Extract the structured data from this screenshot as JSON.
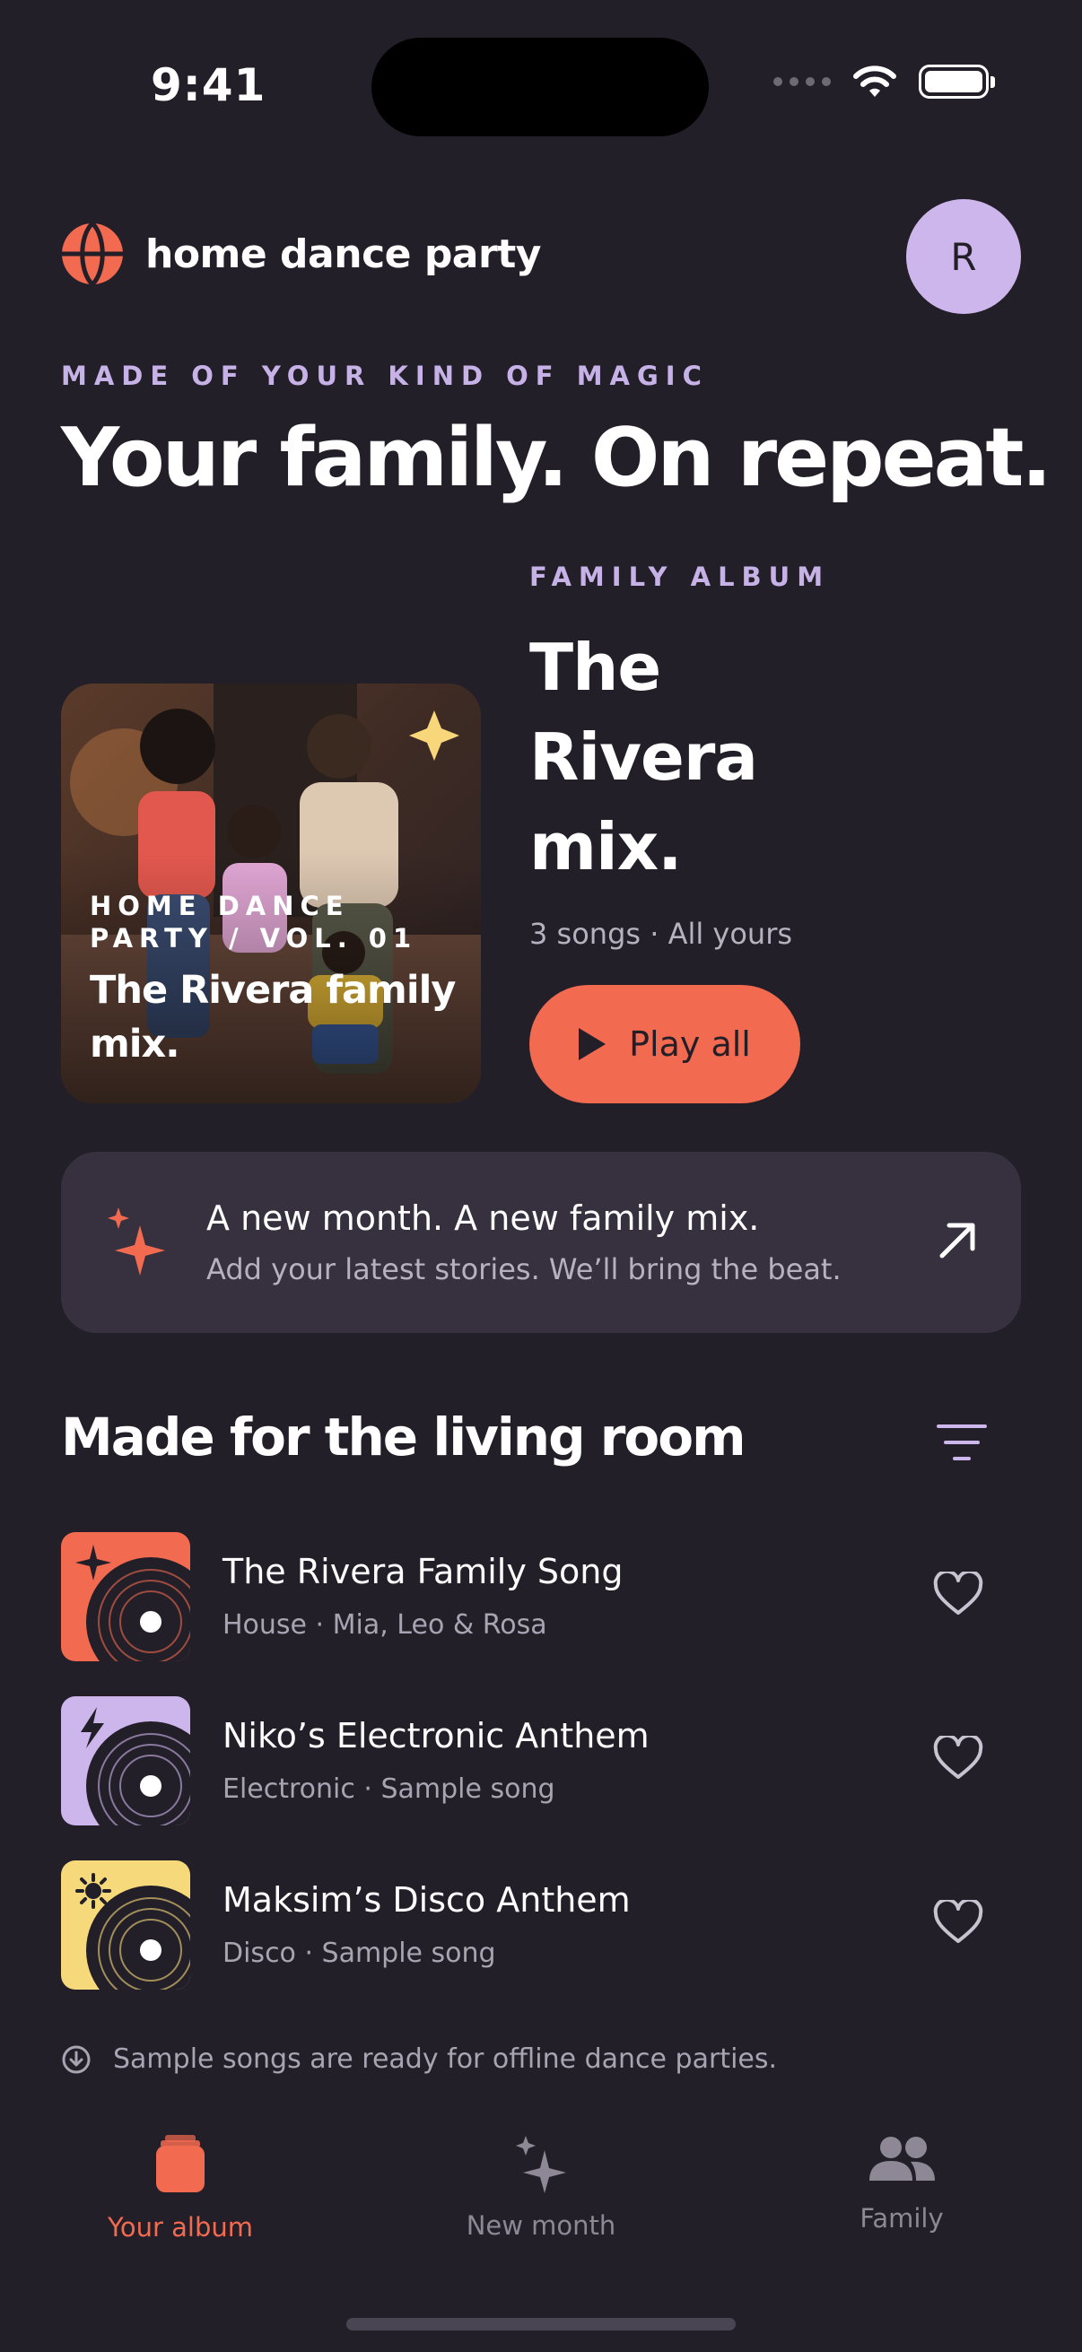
{
  "status_bar": {
    "time": "9:41"
  },
  "header": {
    "brand": "home dance party",
    "avatar_initial": "R",
    "brand_icon": "globe-icon"
  },
  "hero": {
    "eyebrow": "MADE OF YOUR KIND OF MAGIC",
    "title": "Your family. On repeat."
  },
  "album": {
    "art_volume": "HOME DANCE PARTY / VOL. 01",
    "art_title": "The Rivera family mix.",
    "label": "FAMILY ALBUM",
    "title": "The Rivera mix.",
    "meta": "3 songs · All yours",
    "play_label": "Play all"
  },
  "banner": {
    "title": "A new month. A new family mix.",
    "subtitle": "Add your latest stories. We’ll bring the beat."
  },
  "section": {
    "title": "Made for the living room"
  },
  "songs": [
    {
      "title": "The Rivera Family Song",
      "subtitle": "House · Mia, Leo & Rosa",
      "color": "#f26a4f",
      "icon": "sparkle-icon"
    },
    {
      "title": "Niko’s Electronic Anthem",
      "subtitle": "Electronic · Sample song",
      "color": "#cdb6ec",
      "icon": "bolt-icon"
    },
    {
      "title": "Maksim’s Disco Anthem",
      "subtitle": "Disco · Sample song",
      "color": "#f5d97a",
      "icon": "sun-icon"
    }
  ],
  "offline_note": "Sample songs are ready for offline dance parties.",
  "tabs": [
    {
      "label": "Your album",
      "active": true
    },
    {
      "label": "New month",
      "active": false
    },
    {
      "label": "Family",
      "active": false
    }
  ],
  "colors": {
    "background": "#231f29",
    "accent": "#f26a4f",
    "lavender": "#c7b2e8",
    "card": "#37313f"
  }
}
